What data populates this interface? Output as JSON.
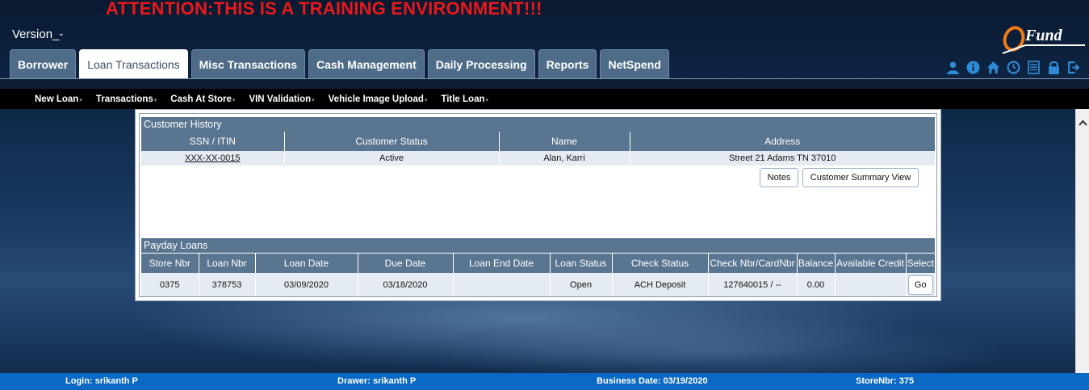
{
  "banner": "ATTENTION:THIS IS A TRAINING ENVIRONMENT!!!",
  "version": "Version_-",
  "logo_text": "Fund",
  "tabs": [
    {
      "label": "Borrower"
    },
    {
      "label": "Loan Transactions"
    },
    {
      "label": "Misc Transactions"
    },
    {
      "label": "Cash Management"
    },
    {
      "label": "Daily Processing"
    },
    {
      "label": "Reports"
    },
    {
      "label": "NetSpend"
    }
  ],
  "active_tab": "Loan Transactions",
  "header_icons": [
    "user-icon",
    "info-icon",
    "home-icon",
    "clock-icon",
    "list-icon",
    "lock-icon",
    "logout-icon"
  ],
  "submenu": [
    {
      "label": "New Loan"
    },
    {
      "label": "Transactions"
    },
    {
      "label": "Cash At Store"
    },
    {
      "label": "VIN Validation"
    },
    {
      "label": "Vehicle Image Upload"
    },
    {
      "label": "Title Loan"
    }
  ],
  "customer_history": {
    "title": "Customer History",
    "columns": [
      "SSN / ITIN",
      "Customer Status",
      "Name",
      "Address"
    ],
    "row": {
      "ssn": "XXX-XX-0015",
      "status": "Active",
      "name": "Alan,  Karri",
      "address": "Street 21  Adams TN 37010"
    },
    "notes_button": "Notes",
    "summary_button": "Customer Summary View"
  },
  "payday_loans": {
    "title": "Payday Loans",
    "columns": [
      "Store Nbr",
      "Loan Nbr",
      "Loan Date",
      "Due Date",
      "Loan End Date",
      "Loan Status",
      "Check Status",
      "Check Nbr/CardNbr",
      "Balance",
      "Available Credit",
      "Select"
    ],
    "rows": [
      {
        "store_nbr": "0375",
        "loan_nbr": "378753",
        "loan_date": "03/09/2020",
        "due_date": "03/18/2020",
        "loan_end_date": "",
        "loan_status": "Open",
        "check_status": "ACH Deposit",
        "check_nbr": "127640015 / --",
        "balance": "0.00",
        "available_credit": "",
        "select_label": "Go"
      }
    ]
  },
  "footer": {
    "login": "Login: srikanth P",
    "drawer": "Drawer: srikanth P",
    "business_date": "Business Date: 03/19/2020",
    "store_nbr": "StoreNbr: 375"
  },
  "colors": {
    "banner": "#e8191b",
    "tab_bg": "#4e6b87",
    "table_header": "#5a7590",
    "footer": "#0a69c4"
  }
}
